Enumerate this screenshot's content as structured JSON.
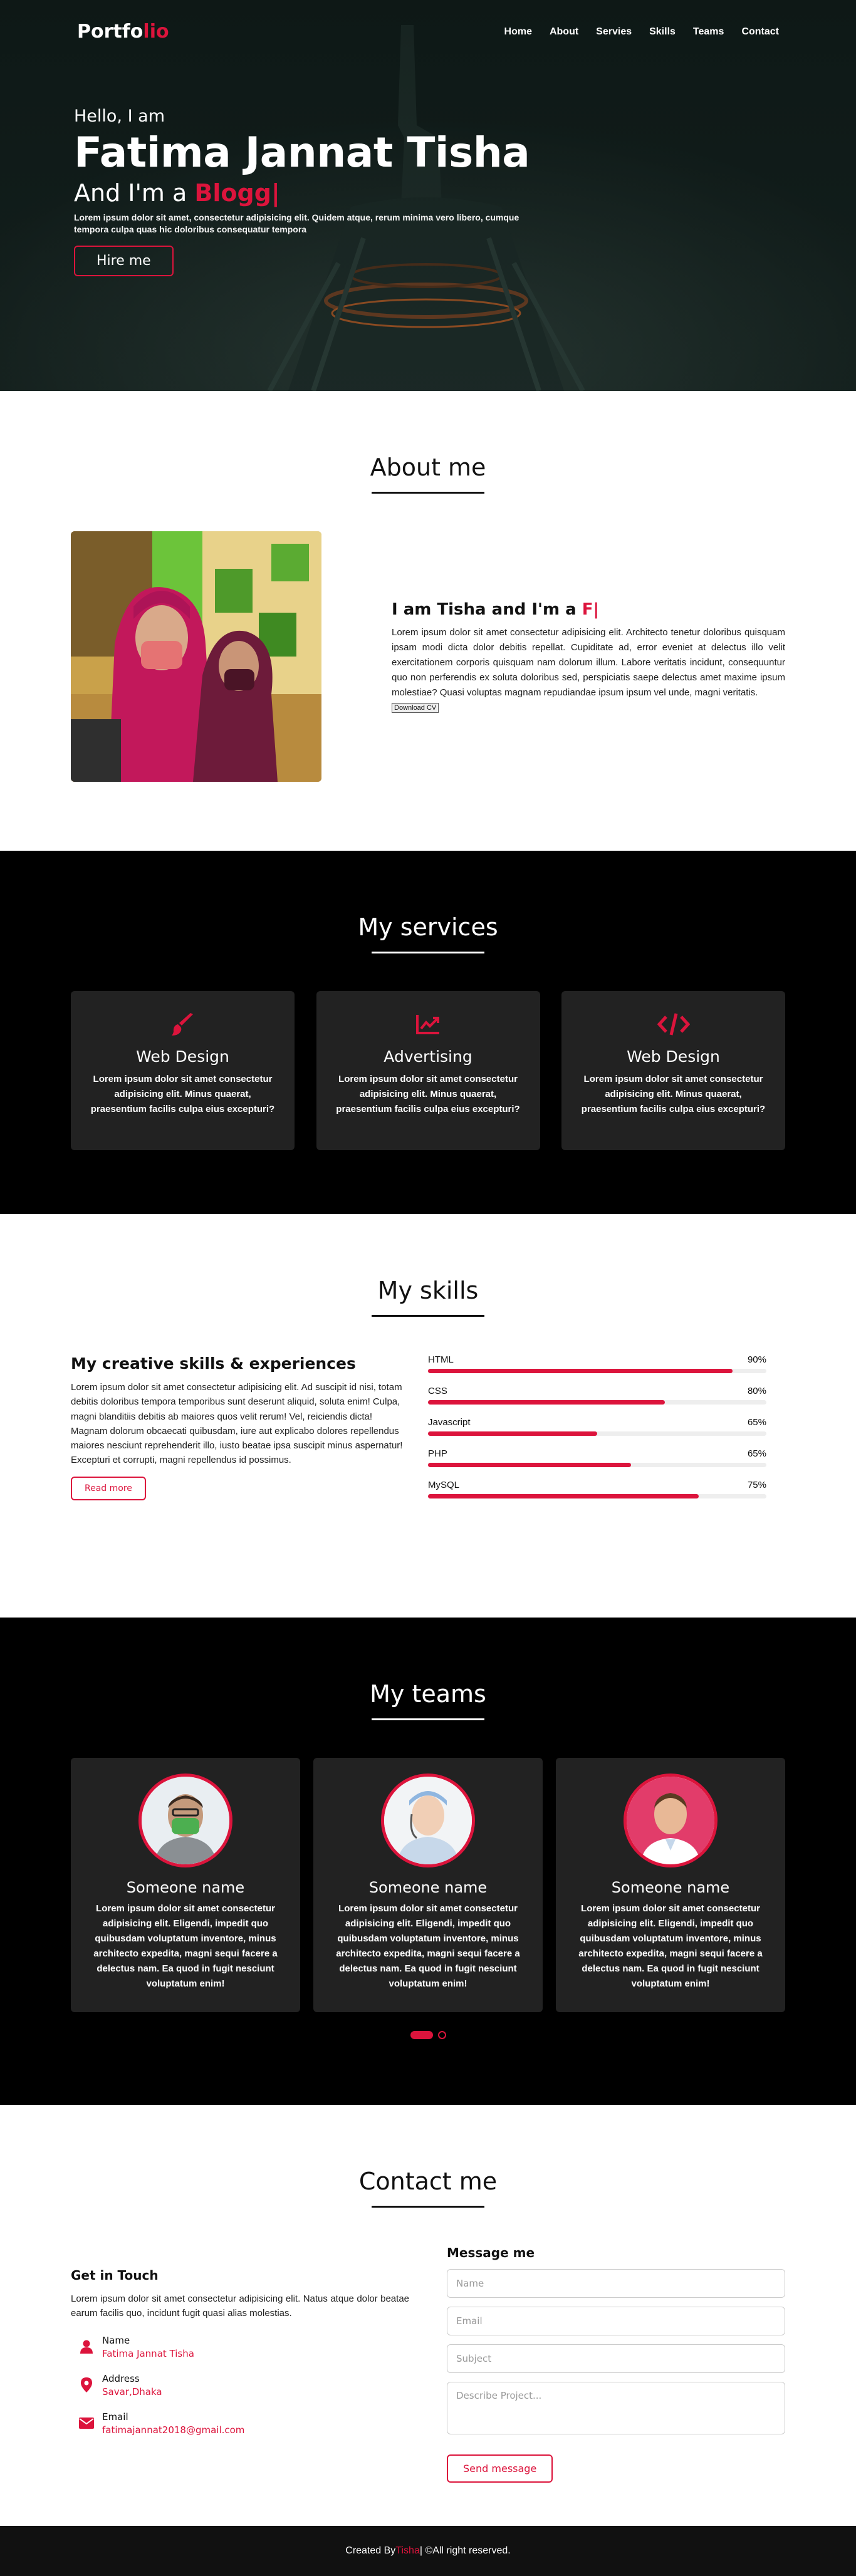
{
  "colors": {
    "accent": "#dc143c",
    "dark_bg": "#000000",
    "card_bg": "#222222"
  },
  "navbar": {
    "logo_main": "Portfo",
    "logo_accent": "lio",
    "menu": [
      "Home",
      "About",
      "Servies",
      "Skills",
      "Teams",
      "Contact"
    ]
  },
  "home": {
    "hello": "Hello, I am",
    "name": "Fatima Jannat Tisha",
    "role_prefix": "And I'm a ",
    "role_typed": "Blogg|",
    "description": "Lorem ipsum dolor sit amet, consectetur adipisicing elit. Quidem atque, rerum minima vero libero, cumque tempora culpa quas hic doloribus consequatur tempora",
    "hire_button": "Hire me"
  },
  "about": {
    "title": "About me",
    "heading_prefix": "I am Tisha and I'm a ",
    "heading_typed": "F|",
    "text": "Lorem ipsum dolor sit amet consectetur adipisicing elit. Architecto tenetur doloribus quisquam ipsam modi dicta dolor debitis repellat. Cupiditate ad, error eveniet at delectus illo velit exercitationem corporis quisquam nam dolorum illum. Labore veritatis incidunt, consequuntur quo non perferendis ex soluta doloribus sed, perspiciatis saepe delectus amet maxime ipsum molestiae? Quasi voluptas magnam repudiandae ipsum ipsum vel unde, magni veritatis.",
    "download_button": "Download CV"
  },
  "services": {
    "title": "My services",
    "cards": [
      {
        "icon": "paint-brush-icon",
        "title": "Web Design",
        "text": "Lorem ipsum dolor sit amet consectetur adipisicing elit. Minus quaerat, praesentium facilis culpa eius excepturi?"
      },
      {
        "icon": "chart-line-icon",
        "title": "Advertising",
        "text": "Lorem ipsum dolor sit amet consectetur adipisicing elit. Minus quaerat, praesentium facilis culpa eius excepturi?"
      },
      {
        "icon": "code-icon",
        "title": "Web Design",
        "text": "Lorem ipsum dolor sit amet consectetur adipisicing elit. Minus quaerat, praesentium facilis culpa eius excepturi?"
      }
    ]
  },
  "skills": {
    "title": "My skills",
    "heading": "My creative skills & experiences",
    "text": "Lorem ipsum dolor sit amet consectetur adipisicing elit. Ad suscipit id nisi, totam debitis doloribus tempora temporibus sunt deserunt aliquid, soluta enim! Culpa, magni blanditiis debitis ab maiores quos velit rerum! Vel, reiciendis dicta! Magnam dolorum obcaecati quibusdam, iure aut explicabo dolores repellendus maiores nesciunt reprehenderit illo, iusto beatae ipsa suscipit minus aspernatur! Excepturi et corrupti, magni repellendus id possimus.",
    "read_more": "Read more",
    "bars": [
      {
        "name": "HTML",
        "percent_label": "90%",
        "level": 0.9
      },
      {
        "name": "CSS",
        "percent_label": "80%",
        "level": 0.7
      },
      {
        "name": "Javascript",
        "percent_label": "65%",
        "level": 0.5
      },
      {
        "name": "PHP",
        "percent_label": "65%",
        "level": 0.6
      },
      {
        "name": "MySQL",
        "percent_label": "75%",
        "level": 0.8
      }
    ]
  },
  "teams": {
    "title": "My teams",
    "members": [
      {
        "name": "Someone name",
        "text": "Lorem ipsum dolor sit amet consectetur adipisicing elit. Eligendi, impedit quo quibusdam voluptatum inventore, minus architecto expedita, magni sequi facere a delectus nam. Ea quod in fugit nesciunt voluptatum enim!"
      },
      {
        "name": "Someone name",
        "text": "Lorem ipsum dolor sit amet consectetur adipisicing elit. Eligendi, impedit quo quibusdam voluptatum inventore, minus architecto expedita, magni sequi facere a delectus nam. Ea quod in fugit nesciunt voluptatum enim!"
      },
      {
        "name": "Someone name",
        "text": "Lorem ipsum dolor sit amet consectetur adipisicing elit. Eligendi, impedit quo quibusdam voluptatum inventore, minus architecto expedita, magni sequi facere a delectus nam. Ea quod in fugit nesciunt voluptatum enim!"
      }
    ]
  },
  "contact": {
    "title": "Contact me",
    "get_in_touch": "Get in Touch",
    "text": "Lorem ipsum dolor sit amet consectetur adipisicing elit. Natus atque dolor beatae earum facilis quo, incidunt fugit quasi alias molestias.",
    "name_head": "Name",
    "name_value": "Fatima Jannat Tisha",
    "address_head": "Address",
    "address_value": "Savar,Dhaka",
    "email_head": "Email",
    "email_value": "fatimajannat2018@gmail.com",
    "message_heading": "Message me",
    "placeholders": {
      "name": "Name",
      "email": "Email",
      "subject": "Subject",
      "project": "Describe Project..."
    },
    "send_button": "Send message"
  },
  "footer": {
    "prefix": "Created By ",
    "accent": "Tisha",
    "suffix": "| ©All right reserved."
  }
}
